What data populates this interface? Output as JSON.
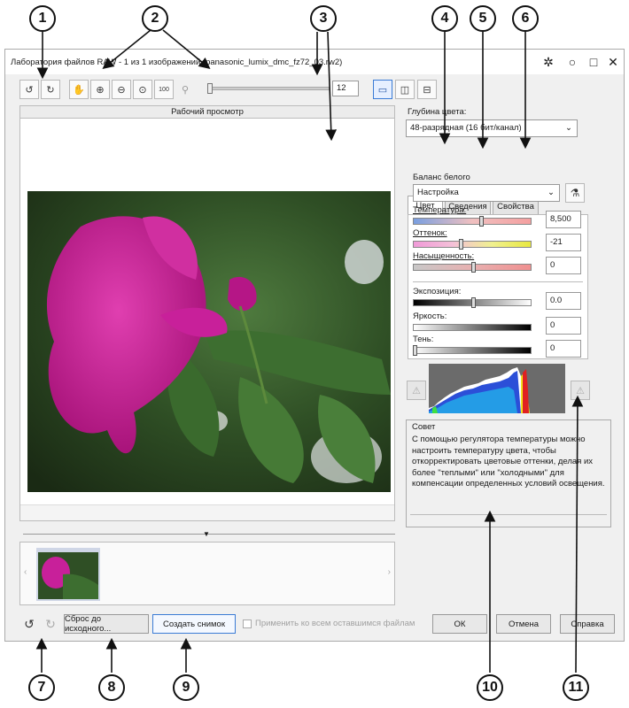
{
  "window": {
    "title": "Лаборатория файлов RAW - 1 из 1 изображений (panasonic_lumix_dmc_fz72_03.rw2)"
  },
  "toolbar": {
    "zoom_value": "12"
  },
  "preview": {
    "header": "Рабочий просмотр"
  },
  "right": {
    "color_depth_label": "Глубина цвета:",
    "color_depth_value": "48-разрядная (16 бит/канал)",
    "tabs": [
      "Цвет",
      "Сведения",
      "Свойства"
    ],
    "white_balance_label": "Баланс белого",
    "white_balance_value": "Настройка",
    "temperature_label": "Температура:",
    "temperature_value": "8,500",
    "tint_label": "Оттенок:",
    "tint_value": "-21",
    "saturation_label": "Насыщенность:",
    "saturation_value": "0",
    "exposure_label": "Экспозиция:",
    "exposure_value": "0.0",
    "brightness_label": "Яркость:",
    "brightness_value": "0",
    "shadow_label": "Тень:",
    "shadow_value": "0",
    "tips_title": "Совет",
    "tips_text": "С помощью регулятора температуры можно настроить температуру цвета, чтобы откорректировать цветовые оттенки, делая их более \"теплыми\" или \"холодными\" для компенсации определенных условий освещения."
  },
  "footer": {
    "reset_label": "Сброс до исходного...",
    "snapshot_label": "Создать снимок",
    "apply_all_label": "Применить ко всем оставшимся файлам",
    "ok_label": "ОК",
    "cancel_label": "Отмена",
    "help_label": "Справка"
  },
  "callouts": [
    "1",
    "2",
    "3",
    "4",
    "5",
    "6",
    "7",
    "8",
    "9",
    "10",
    "11"
  ],
  "icons": [
    "rotate-left-icon",
    "rotate-right-icon",
    "hand-icon",
    "zoom-in-icon",
    "zoom-out-icon",
    "zoom-fit-icon",
    "zoom-100-icon",
    "zoom-small-icon",
    "single-view-icon",
    "split-view-icon",
    "compare-view-icon",
    "eyedropper-icon",
    "warning-icon",
    "undo-icon",
    "redo-icon",
    "chevron-down-icon"
  ],
  "colors": {
    "accent": "#3a7bd5",
    "window_bg": "#f0f0f0"
  }
}
